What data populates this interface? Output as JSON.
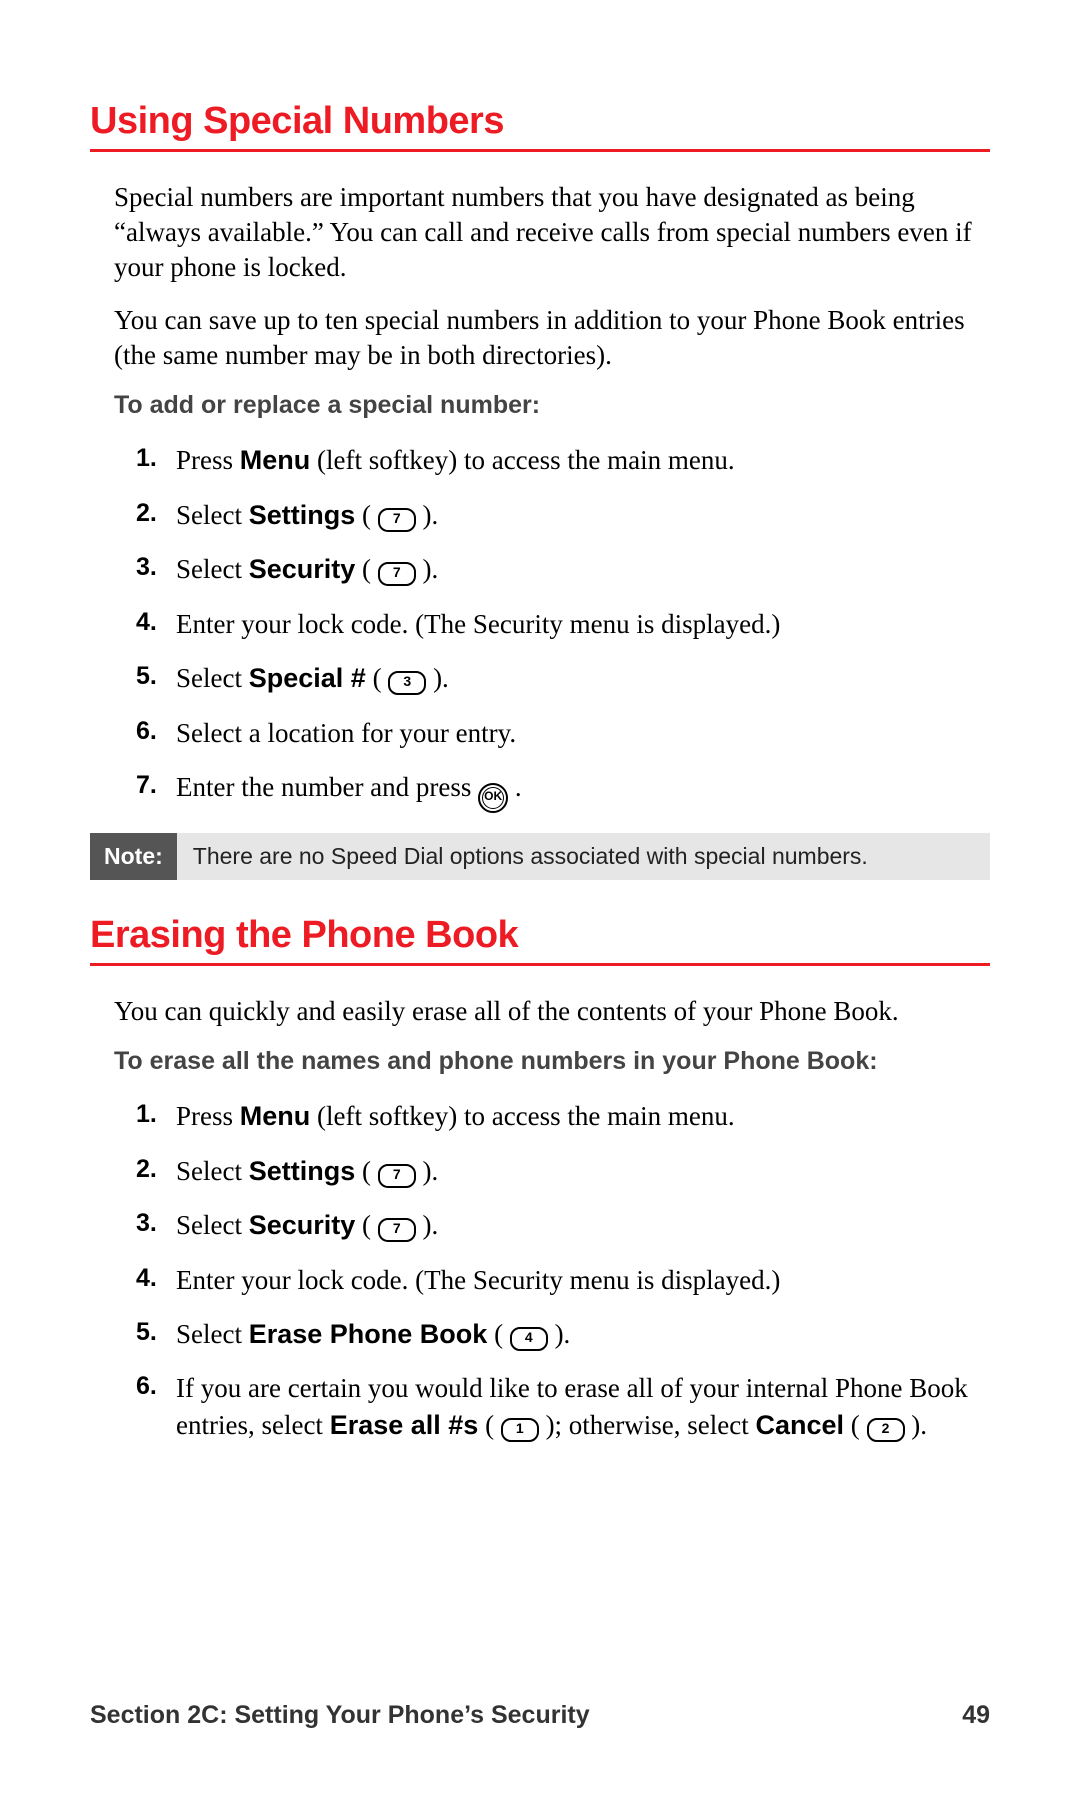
{
  "section1": {
    "heading": "Using Special Numbers",
    "para1": "Special numbers are important numbers that you have designated as being “always available.” You can call and receive calls from special numbers even if your phone is locked.",
    "para2": "You can save up to ten special numbers in addition to your Phone Book entries (the same number may be in both directories).",
    "subhead": "To add or replace a special number:",
    "steps": {
      "s1_a": "Press ",
      "s1_b": "Menu",
      "s1_c": " (left softkey) to access the main menu.",
      "s2_a": "Select ",
      "s2_b": "Settings",
      "s2_c": " ( ",
      "s2_key": "7",
      "s2_d": " ).",
      "s3_a": "Select ",
      "s3_b": "Security",
      "s3_c": " ( ",
      "s3_key": "7",
      "s3_d": " ).",
      "s4": "Enter your lock code. (The Security menu is displayed.)",
      "s5_a": "Select ",
      "s5_b": "Special #",
      "s5_c": " ( ",
      "s5_key": "3",
      "s5_d": " ).",
      "s6": "Select a location for your entry.",
      "s7_a": "Enter the number and press ",
      "s7_ok": "OK",
      "s7_b": " ."
    },
    "nums": {
      "n1": "1.",
      "n2": "2.",
      "n3": "3.",
      "n4": "4.",
      "n5": "5.",
      "n6": "6.",
      "n7": "7."
    },
    "note_label": "Note:",
    "note_text": "There are no Speed Dial options associated with special numbers."
  },
  "section2": {
    "heading": "Erasing the Phone Book",
    "para1": "You can quickly and easily erase all of the contents of your Phone Book.",
    "subhead": "To erase all the names and phone numbers in your Phone Book:",
    "steps": {
      "s1_a": "Press ",
      "s1_b": "Menu",
      "s1_c": " (left softkey) to access the main menu.",
      "s2_a": "Select ",
      "s2_b": "Settings",
      "s2_c": " ( ",
      "s2_key": "7",
      "s2_d": " ).",
      "s3_a": "Select ",
      "s3_b": "Security",
      "s3_c": " ( ",
      "s3_key": "7",
      "s3_d": " ).",
      "s4": "Enter your lock code. (The Security menu is displayed.)",
      "s5_a": "Select ",
      "s5_b": "Erase Phone Book",
      "s5_c": " ( ",
      "s5_key": "4",
      "s5_d": " ).",
      "s6_a": "If you are certain you would like to erase all of your internal Phone Book entries, select ",
      "s6_b": "Erase all #s",
      "s6_c": " ( ",
      "s6_key1": "1",
      "s6_d": " ); otherwise, select ",
      "s6_e": "Cancel",
      "s6_f": " ( ",
      "s6_key2": "2",
      "s6_g": " )."
    },
    "nums": {
      "n1": "1.",
      "n2": "2.",
      "n3": "3.",
      "n4": "4.",
      "n5": "5.",
      "n6": "6."
    }
  },
  "footer": {
    "section_label": "Section 2C: Setting Your Phone’s Security",
    "page_number": "49"
  }
}
